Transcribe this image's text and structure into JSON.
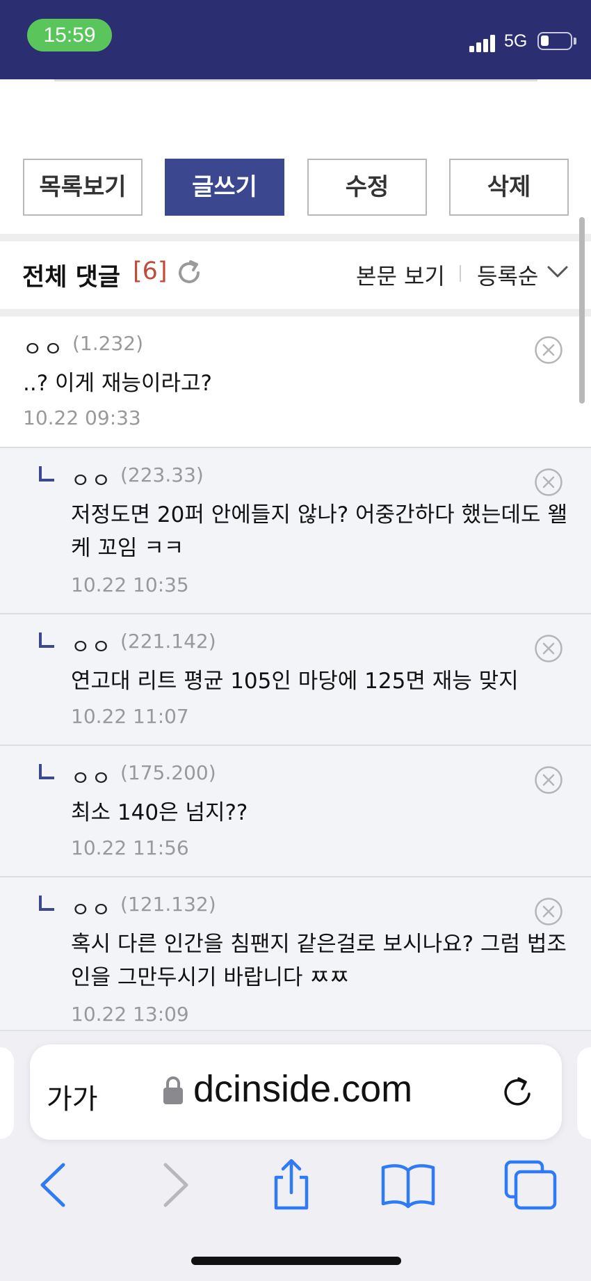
{
  "status_bar": {
    "time": "15:59",
    "network": "5G",
    "battery_level": 0.25,
    "signal_bars": 4,
    "background_color": "#2b2f72",
    "time_pill_color": "#59c55b"
  },
  "actions": {
    "list": "목록보기",
    "write": "글쓰기",
    "edit": "수정",
    "delete": "삭제"
  },
  "comments_header": {
    "title": "전체 댓글",
    "count": "[6]",
    "view_body": "본문 보기",
    "sort": "등록순"
  },
  "comments": [
    {
      "author": "ㅇㅇ",
      "ip": "(1.232)",
      "text": "..? 이게 재능이라고?",
      "date": "10.22 09:33",
      "reply": false
    },
    {
      "author": "ㅇㅇ",
      "ip": "(223.33)",
      "text": "저정도면 20퍼 안에들지 않나? 어중간하다 했는데도 왤케 꼬임 ㅋㅋ",
      "date": "10.22 10:35",
      "reply": true
    },
    {
      "author": "ㅇㅇ",
      "ip": "(221.142)",
      "text": "연고대 리트 평균 105인 마당에 125면 재능 맞지",
      "date": "10.22 11:07",
      "reply": true
    },
    {
      "author": "ㅇㅇ",
      "ip": "(175.200)",
      "text": "최소 140은 넘지??",
      "date": "10.22 11:56",
      "reply": true
    },
    {
      "author": "ㅇㅇ",
      "ip": "(121.132)",
      "text": "혹시 다른 인간을 침팬지 같은걸로 보시나요? 그럼 법조인을 그만두시기 바랍니다 ㅉㅉ",
      "date": "10.22 13:09",
      "reply": true
    }
  ],
  "browser": {
    "text_size": "가가",
    "url": "dcinside.com"
  },
  "icons": {
    "refresh": "refresh-icon",
    "chevron": "chevron-down-icon",
    "delete": "delete-circle-x-icon",
    "lock": "lock-icon",
    "reload": "reload-icon",
    "back": "back-arrow-icon",
    "forward": "forward-arrow-icon",
    "share": "share-icon",
    "bookmarks": "bookmarks-icon",
    "tabs": "tabs-icon"
  },
  "colors": {
    "accent": "#3b4890",
    "count": "#c24a3a",
    "ios_blue": "#2f7bf5"
  }
}
